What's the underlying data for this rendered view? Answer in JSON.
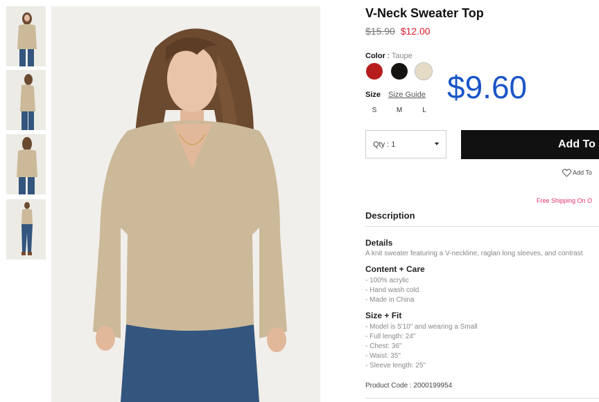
{
  "product": {
    "title": "V-Neck Sweater Top",
    "old_price": "$15.90",
    "sale_price": "$12.00",
    "overlay_price": "$9.60"
  },
  "color": {
    "label": "Color",
    "separator": " : ",
    "selected_value": "Taupe",
    "swatches": [
      {
        "name": "Burgundy",
        "hex": "#b71c1c"
      },
      {
        "name": "Black",
        "hex": "#161410"
      },
      {
        "name": "Taupe",
        "hex": "#e6dcc6"
      }
    ]
  },
  "size": {
    "label": "Size",
    "guide_link": "Size Guide",
    "options": [
      "S",
      "M",
      "L"
    ]
  },
  "quantity": {
    "label": "Qty : 1"
  },
  "actions": {
    "add_to_bag": "Add To",
    "wishlist": "Add To"
  },
  "shipping": {
    "note": "Free Shipping On O"
  },
  "description": {
    "heading": "Description",
    "details_heading": "Details",
    "details_text": "A knit sweater featuring a V-neckline, raglan long sleeves, and contrast",
    "care_heading": "Content + Care",
    "care_items": [
      "- 100% acrylic",
      "- Hand wash cold",
      "- Made in China"
    ],
    "fit_heading": "Size + Fit",
    "fit_items": [
      "- Model is 5'10\" and wearing a Small",
      "- Full length: 24\"",
      "- Chest: 36\"",
      "- Waist: 35\"",
      "- Sleeve length: 25\""
    ],
    "product_code": "Product Code : 2000199954"
  },
  "colors": {
    "sale": "#d81c2c",
    "overlay": "#1a55c8",
    "button": "#111111",
    "shipping": "#e0306a",
    "sweater": "#cbb99a",
    "jeans": "#33557e",
    "hair": "#6b4a30"
  }
}
